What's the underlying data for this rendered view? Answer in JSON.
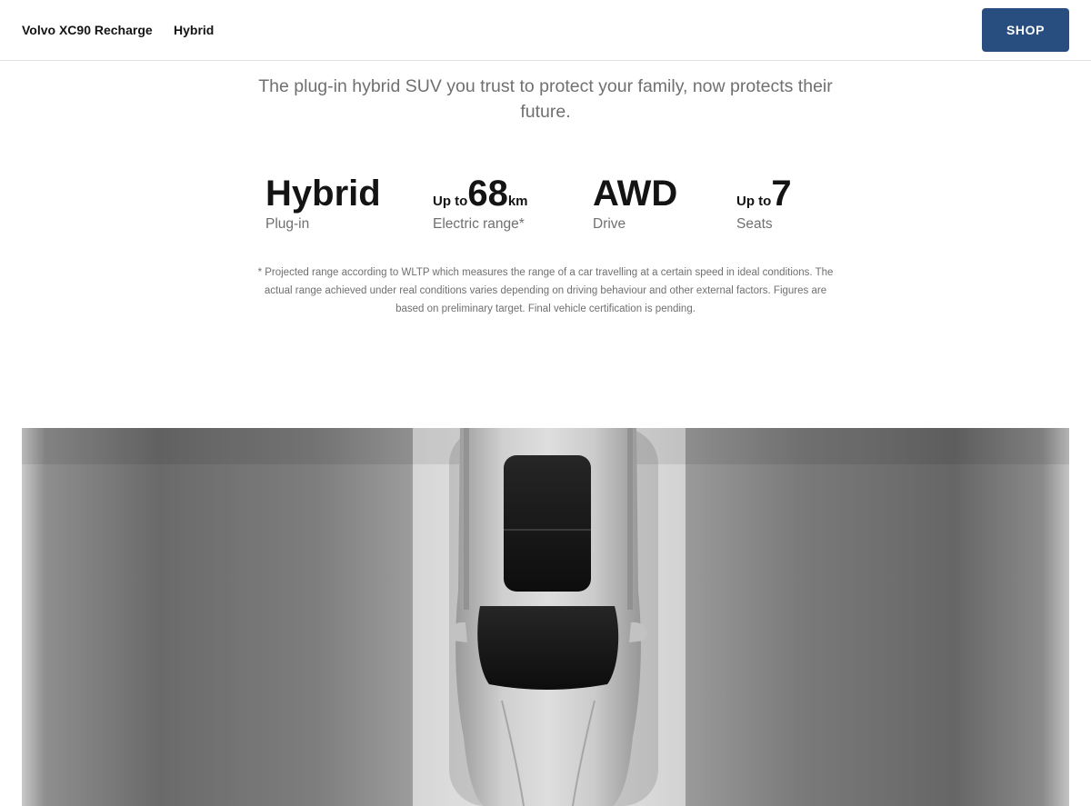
{
  "header": {
    "model_name": "Volvo XC90 Recharge",
    "nav_link": "Hybrid",
    "shop_label": "SHOP"
  },
  "intro": {
    "text": "The plug-in hybrid SUV you trust to protect your family, now protects their future."
  },
  "specs": [
    {
      "prefix": "",
      "value": "Hybrid",
      "unit": "",
      "label": "Plug-in"
    },
    {
      "prefix": "Up to",
      "value": "68",
      "unit": "km",
      "label": "Electric range*"
    },
    {
      "prefix": "",
      "value": "AWD",
      "unit": "",
      "label": "Drive"
    },
    {
      "prefix": "Up to",
      "value": "7",
      "unit": "",
      "label": "Seats"
    }
  ],
  "footnote": {
    "text": "* Projected range according to WLTP which measures the range of a car travelling at a certain speed in ideal conditions. The actual range achieved under real conditions varies depending on driving behaviour and other external factors. Figures are based on preliminary target. Final vehicle certification is pending."
  },
  "colors": {
    "shop_button": "#284e80",
    "primary_text": "#141414",
    "secondary_text": "#707070"
  }
}
